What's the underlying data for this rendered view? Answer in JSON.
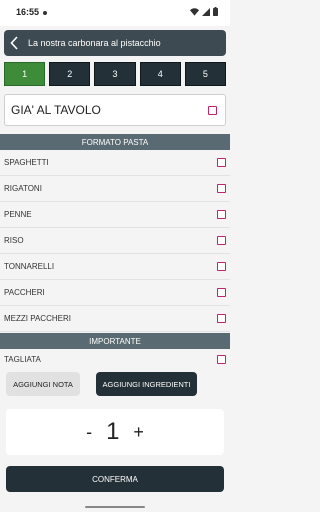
{
  "status_bar": {
    "time": "16:55"
  },
  "header": {
    "title": "La nostra carbonara al pistacchio"
  },
  "steps": [
    "1",
    "2",
    "3",
    "4",
    "5"
  ],
  "tavolo": {
    "label": "GIA' AL TAVOLO"
  },
  "section_formato": {
    "title": "FORMATO PASTA"
  },
  "formato_items": [
    "SPAGHETTI",
    "RIGATONI",
    "PENNE",
    "RISO",
    "TONNARELLI",
    "PACCHERI",
    "MEZZI PACCHERI"
  ],
  "section_importante": {
    "title": "IMPORTANTE"
  },
  "importante_items": [
    "TAGLIATA"
  ],
  "buttons": {
    "nota": "AGGIUNGI NOTA",
    "ingredienti": "AGGIUNGI INGREDIENTI",
    "confirm": "CONFERMA"
  },
  "quantity": {
    "minus": "-",
    "value": "1",
    "plus": "+"
  },
  "colors": {
    "accent_green": "#3e8b3a",
    "dark": "#243037",
    "header": "#3d4a52",
    "checkbox": "#c0246e"
  }
}
